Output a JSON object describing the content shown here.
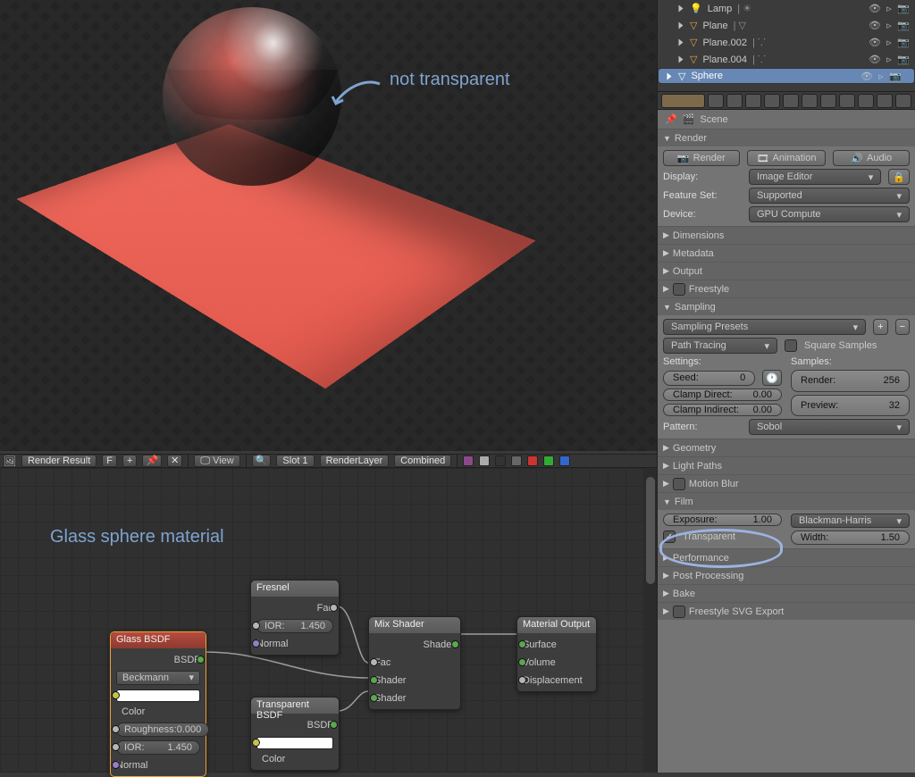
{
  "annotations": {
    "not_transparent": "not transparent",
    "glass_material": "Glass sphere material"
  },
  "image_header": {
    "render_result": "Render Result",
    "f": "F",
    "view": "View",
    "slot": "Slot 1",
    "layer": "RenderLayer",
    "pass": "Combined"
  },
  "nodes": {
    "glass": {
      "title": "Glass BSDF",
      "out": "BSDF",
      "dist": "Beckmann",
      "color": "Color",
      "roughness_label": "Roughness:",
      "roughness_val": "0.000",
      "ior_label": "IOR:",
      "ior_val": "1.450",
      "normal": "Normal"
    },
    "fresnel": {
      "title": "Fresnel",
      "out": "Fac",
      "ior_label": "IOR:",
      "ior_val": "1.450",
      "normal": "Normal"
    },
    "transparent": {
      "title": "Transparent BSDF",
      "out": "BSDF",
      "color": "Color"
    },
    "mix": {
      "title": "Mix Shader",
      "out": "Shader",
      "fac": "Fac",
      "shader": "Shader"
    },
    "output": {
      "title": "Material Output",
      "surface": "Surface",
      "volume": "Volume",
      "displacement": "Displacement"
    }
  },
  "outliner": {
    "items": [
      {
        "name": "Lamp",
        "icon": "lamp"
      },
      {
        "name": "Plane",
        "icon": "mesh"
      },
      {
        "name": "Plane.002",
        "icon": "mesh"
      },
      {
        "name": "Plane.004",
        "icon": "mesh"
      },
      {
        "name": "Sphere",
        "icon": "mesh",
        "selected": true
      }
    ]
  },
  "properties": {
    "scene": "Scene",
    "render": {
      "title": "Render",
      "render_btn": "Render",
      "animation_btn": "Animation",
      "audio_btn": "Audio",
      "display_label": "Display:",
      "display_val": "Image Editor",
      "feature_label": "Feature Set:",
      "feature_val": "Supported",
      "device_label": "Device:",
      "device_val": "GPU Compute"
    },
    "dimensions": "Dimensions",
    "metadata": "Metadata",
    "output": "Output",
    "freestyle": "Freestyle",
    "sampling": {
      "title": "Sampling",
      "presets": "Sampling Presets",
      "integrator": "Path Tracing",
      "square": "Square Samples",
      "settings": "Settings:",
      "samples": "Samples:",
      "seed_label": "Seed:",
      "seed_val": "0",
      "clamp_direct_label": "Clamp Direct:",
      "clamp_direct_val": "0.00",
      "clamp_indirect_label": "Clamp Indirect:",
      "clamp_indirect_val": "0.00",
      "render_label": "Render:",
      "render_val": "256",
      "preview_label": "Preview:",
      "preview_val": "32",
      "pattern_label": "Pattern:",
      "pattern_val": "Sobol"
    },
    "geometry": "Geometry",
    "light_paths": "Light Paths",
    "motion_blur": "Motion Blur",
    "film": {
      "title": "Film",
      "exposure_label": "Exposure:",
      "exposure_val": "1.00",
      "transparent": "Transparent",
      "filter": "Blackman-Harris",
      "width_label": "Width:",
      "width_val": "1.50"
    },
    "performance": "Performance",
    "post_processing": "Post Processing",
    "bake": "Bake",
    "freestyle_svg": "Freestyle SVG Export"
  }
}
